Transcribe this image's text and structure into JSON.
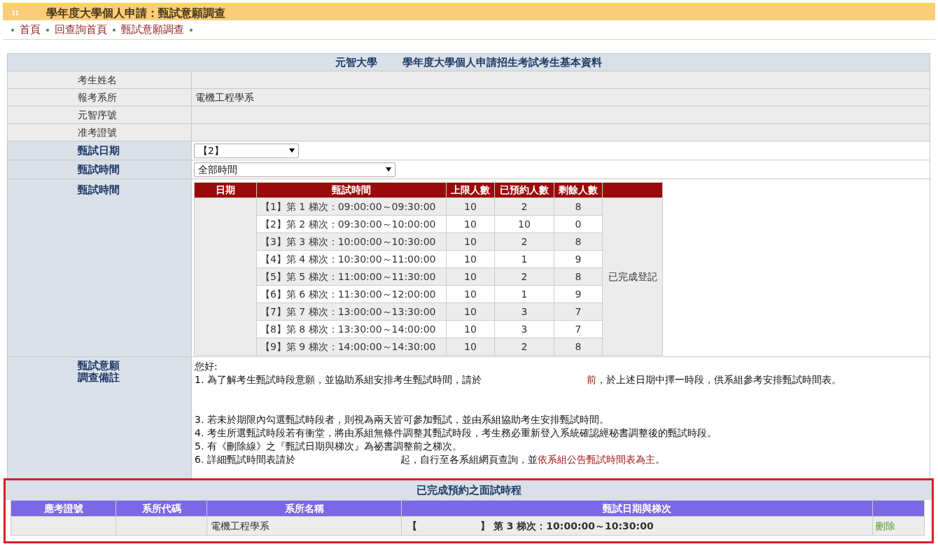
{
  "title_bar": {
    "title": "學年度大學個人申請：甄試意願調查"
  },
  "breadcrumb": [
    {
      "label": "首頁"
    },
    {
      "label": "回查詢首頁"
    },
    {
      "label": "甄試意願調查"
    }
  ],
  "profile": {
    "header": [
      "元智大學",
      "學年度大學個人申請招生考試考生基本資料"
    ],
    "info_rows": [
      {
        "label": "考生姓名"
      },
      {
        "label": "報考系所",
        "value": "電機工程學系"
      },
      {
        "label": "元智序號"
      },
      {
        "label": "准考證號"
      }
    ],
    "date_field": {
      "label": "甄試日期",
      "value": "【2】"
    },
    "time_field": {
      "label": "甄試時間",
      "value": "全部時間"
    },
    "schedule": {
      "label": "甄試時間",
      "columns": [
        "日期",
        "甄試時間",
        "上限人數",
        "已預約人數",
        "剩餘人數"
      ],
      "status": "已完成登記",
      "rows": [
        {
          "slot": "【1】第 1 梯次：09:00:00～09:30:00",
          "limit": "10",
          "booked": "2",
          "remaining": "8"
        },
        {
          "slot": "【2】第 2 梯次：09:30:00～10:00:00",
          "limit": "10",
          "booked": "10",
          "remaining": "0"
        },
        {
          "slot": "【3】第 3 梯次：10:00:00～10:30:00",
          "limit": "10",
          "booked": "2",
          "remaining": "8"
        },
        {
          "slot": "【4】第 4 梯次：10:30:00～11:00:00",
          "limit": "10",
          "booked": "1",
          "remaining": "9"
        },
        {
          "slot": "【5】第 5 梯次：11:00:00～11:30:00",
          "limit": "10",
          "booked": "2",
          "remaining": "8"
        },
        {
          "slot": "【6】第 6 梯次：11:30:00～12:00:00",
          "limit": "10",
          "booked": "1",
          "remaining": "9"
        },
        {
          "slot": "【7】第 7 梯次：13:00:00～13:30:00",
          "limit": "10",
          "booked": "3",
          "remaining": "7"
        },
        {
          "slot": "【8】第 8 梯次：13:30:00～14:00:00",
          "limit": "10",
          "booked": "3",
          "remaining": "7"
        },
        {
          "slot": "【9】第 9 梯次：14:00:00～14:30:00",
          "limit": "10",
          "booked": "2",
          "remaining": "8"
        }
      ]
    },
    "notes": {
      "label": [
        "甄試意願",
        "調查備註"
      ],
      "lines": [
        {
          "parts": [
            {
              "kind": "plain",
              "text": "您好:"
            }
          ]
        },
        {
          "parts": [
            {
              "kind": "plain",
              "text": "1. 為了解考生甄試時段意願，並協助系組安排考生甄試時間，請於"
            },
            {
              "kind": "emphasis",
              "text": "前",
              "gap_before": true
            },
            {
              "kind": "plain",
              "text": "，於上述日期中擇一時段，供系組參考安排甄試時間表。"
            }
          ]
        },
        {
          "space_before": true,
          "parts": [
            {
              "kind": "plain",
              "text": "3. 若未於期限內勾選甄試時段者，則視為兩天皆可參加甄試，並由系組協助考生安排甄試時間。"
            }
          ]
        },
        {
          "parts": [
            {
              "kind": "plain",
              "text": "4. 考生所選甄試時段若有衝堂，將由系組無條件調整其甄試時段，考生務必重新登入系統確認經秘書調整後的甄試時段。"
            }
          ]
        },
        {
          "parts": [
            {
              "kind": "plain",
              "text": "5. 有《刪除線》之『甄試日期與梯次』為祕書調整前之梯次。"
            }
          ]
        },
        {
          "parts": [
            {
              "kind": "plain",
              "text": "6. 詳細甄試時間表請於"
            },
            {
              "kind": "plain",
              "text": "起，自行至各系組網頁查詢，並",
              "gap_before": true
            },
            {
              "kind": "link",
              "text": "依系組公告甄試時間表為主"
            },
            {
              "kind": "plain",
              "text": "。"
            }
          ]
        }
      ]
    }
  },
  "booked": {
    "title": "已完成預約之面試時程",
    "columns": [
      "應考證號",
      "系所代碼",
      "系所名稱",
      "甄試日期與梯次"
    ],
    "rows": [
      {
        "department": "電機工程學系",
        "date_open": "【",
        "slot": "】 第 3 梯次：10:00:00～10:30:00",
        "action": "刪除"
      }
    ]
  }
}
